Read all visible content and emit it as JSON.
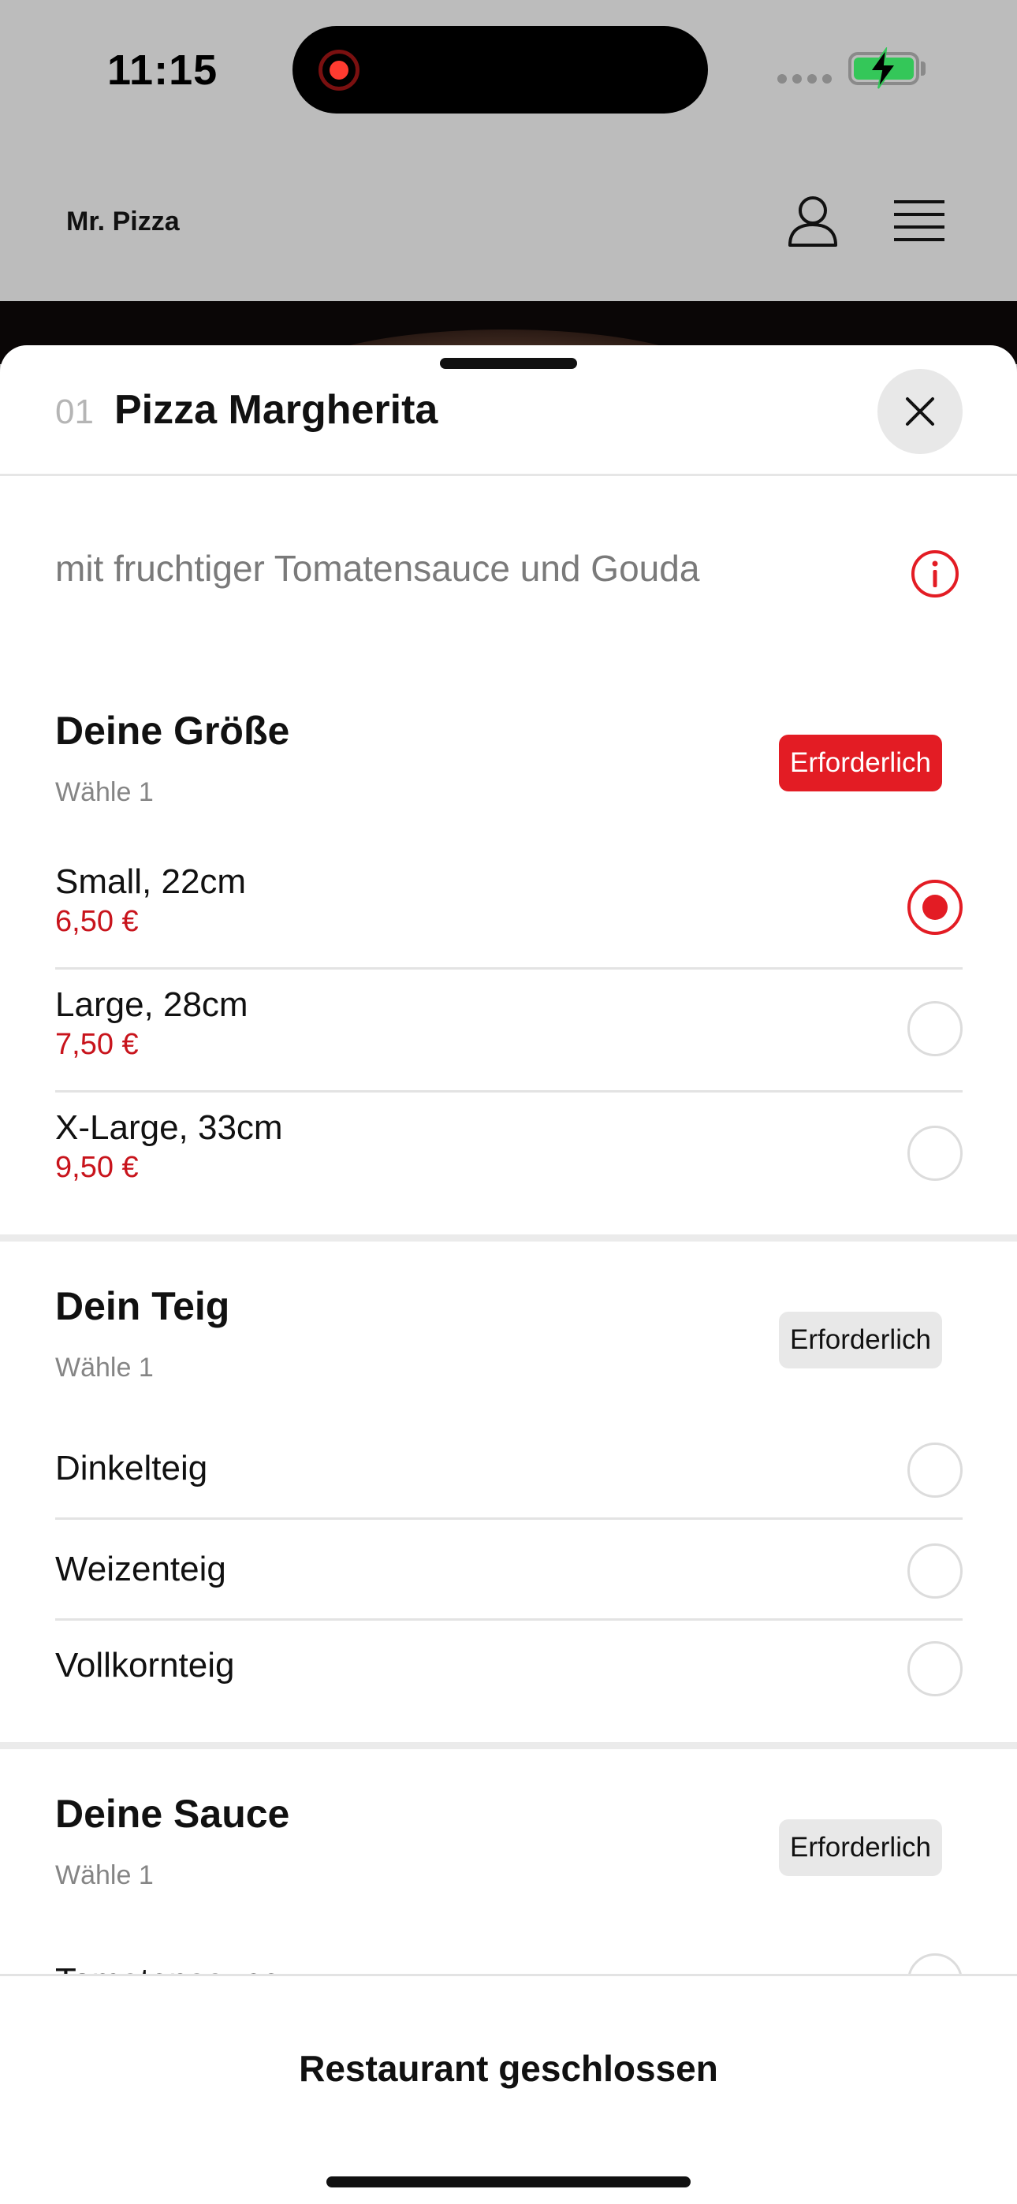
{
  "status_bar": {
    "time": "11:15",
    "recording_indicator": "screen-recording-icon",
    "battery_charging": true,
    "accent_recording": "#ff3b30",
    "accent_battery": "#34c759"
  },
  "header": {
    "brand": "Mr. Pizza",
    "user_icon": "user-icon",
    "menu_icon": "hamburger-menu-icon"
  },
  "sheet": {
    "item_number": "01",
    "item_title": "Pizza Margherita",
    "close_icon": "close-icon",
    "description": "mit fruchtiger Tomatensauce und Gouda",
    "info_icon": "info-icon"
  },
  "sections": {
    "size": {
      "title": "Deine Größe",
      "subtitle": "Wähle 1",
      "badge": "Erforderlich",
      "badge_color": "#e31c24",
      "options": [
        {
          "label": "Small, 22cm",
          "price": "6,50 €",
          "selected": true
        },
        {
          "label": "Large, 28cm",
          "price": "7,50 €",
          "selected": false
        },
        {
          "label": "X-Large, 33cm",
          "price": "9,50 €",
          "selected": false
        }
      ]
    },
    "dough": {
      "title": "Dein Teig",
      "subtitle": "Wähle 1",
      "badge": "Erforderlich",
      "options": [
        {
          "label": "Dinkelteig",
          "selected": false
        },
        {
          "label": "Weizenteig",
          "selected": false
        },
        {
          "label": "Vollkornteig",
          "selected": false
        }
      ]
    },
    "sauce": {
      "title": "Deine Sauce",
      "subtitle": "Wähle 1",
      "badge": "Erforderlich",
      "options": [
        {
          "label": "Tomatensauce",
          "selected": false
        }
      ]
    }
  },
  "footer": {
    "status": "Restaurant geschlossen"
  },
  "colors": {
    "accent_red": "#e31c24",
    "price_red": "#c8141c"
  }
}
